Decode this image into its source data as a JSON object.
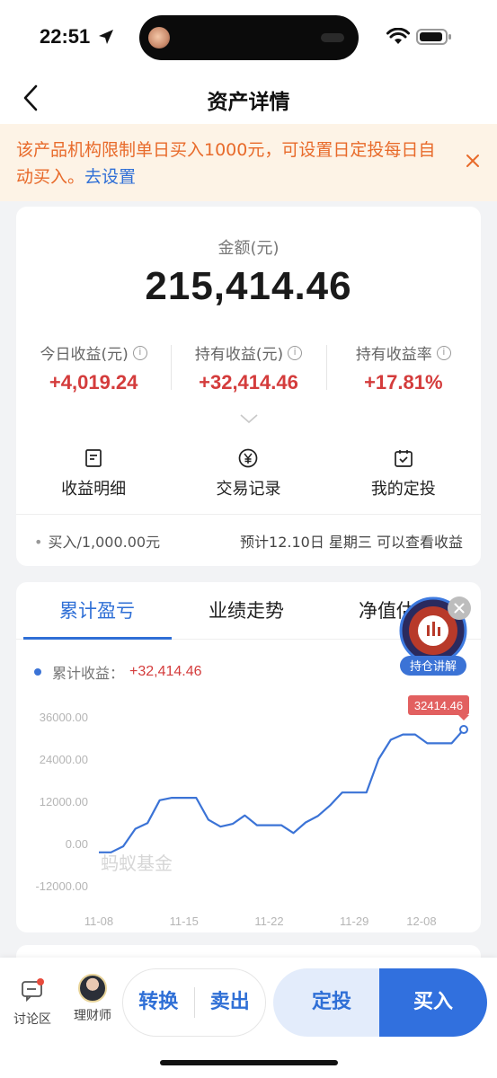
{
  "status_bar": {
    "time": "22:51"
  },
  "nav": {
    "title": "资产详情"
  },
  "notice": {
    "text": "该产品机构限制单日买入1000元，可设置日定投每日自动买入。",
    "link": "去设置"
  },
  "asset": {
    "amount_label": "金额(元)",
    "amount_value": "215,414.46",
    "metrics": [
      {
        "label": "今日收益(元)",
        "value": "+4,019.24"
      },
      {
        "label": "持有收益(元)",
        "value": "+32,414.46"
      },
      {
        "label": "持有收益率",
        "value": "+17.81%"
      }
    ],
    "actions": [
      {
        "label": "收益明细",
        "icon": "document-icon"
      },
      {
        "label": "交易记录",
        "icon": "yen-icon"
      },
      {
        "label": "我的定投",
        "icon": "calendar-check-icon"
      }
    ],
    "pending": {
      "left": "买入/1,000.00元",
      "right": "预计12.10日 星期三 可以查看收益"
    }
  },
  "chart_section": {
    "tabs": [
      "累计盈亏",
      "业绩走势",
      "净值估算"
    ],
    "active_tab": 0,
    "legend_label": "累计收益：",
    "legend_value": "+32,414.46",
    "tooltip": "32414.46",
    "watermark": "蚂蚁基金",
    "float_widget_label": "持仓讲解"
  },
  "chart_data": {
    "type": "line",
    "title": "",
    "xlabel": "",
    "ylabel": "",
    "ylim": [
      -12000,
      36000
    ],
    "y_ticks": [
      "36000.00",
      "24000.00",
      "12000.00",
      "0.00",
      "-12000.00"
    ],
    "y_tick_values": [
      36000,
      24000,
      12000,
      0,
      -12000
    ],
    "x_ticks": [
      "11-08",
      "11-15",
      "11-22",
      "11-29",
      "12-08"
    ],
    "x_tick_index": [
      0,
      7,
      14,
      21,
      28
    ],
    "grid": false,
    "series": [
      {
        "name": "累计收益",
        "color": "#3b73d6",
        "values": [
          -2500,
          -2500,
          -800,
          4200,
          5800,
          12300,
          13000,
          13000,
          13000,
          6800,
          4800,
          5600,
          8000,
          5200,
          5200,
          5200,
          3000,
          6000,
          7800,
          10800,
          14500,
          14500,
          14500,
          24000,
          29500,
          31000,
          31000,
          28500,
          28500,
          28500,
          32414.46
        ]
      }
    ]
  },
  "bottom_bar": {
    "discuss": "讨论区",
    "advisor": "理财师",
    "convert": "转换",
    "sell": "卖出",
    "fixed_invest": "定投",
    "buy": "买入"
  },
  "colors": {
    "accent": "#2f6fd6",
    "gain": "#d43c3c",
    "notice_text": "#e86a2a",
    "notice_bg": "#fdf3e6",
    "buy_button": "#3170de"
  }
}
